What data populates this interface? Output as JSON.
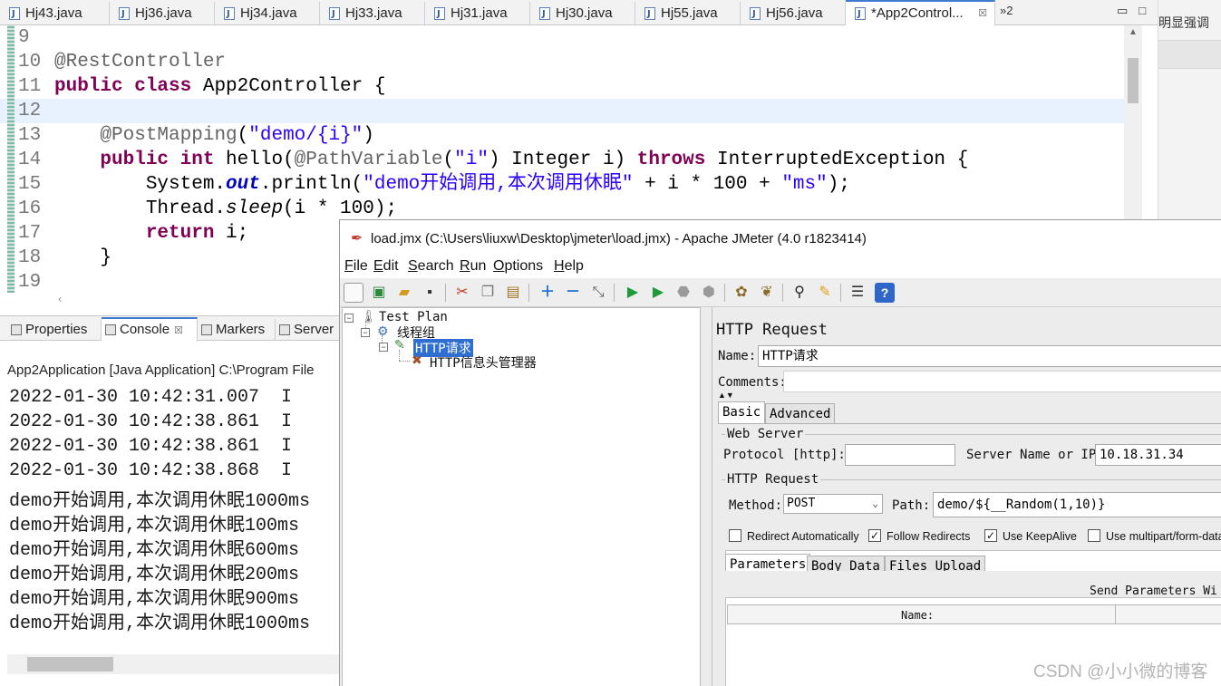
{
  "eclipse": {
    "tabs": [
      "Hj43.java",
      "Hj36.java",
      "Hj34.java",
      "Hj33.java",
      "Hj31.java",
      "Hj30.java",
      "Hj55.java",
      "Hj56.java",
      "*App2Control..."
    ],
    "tab_overflow": "»2",
    "right_strip_text": "明显强调",
    "code_lines": [
      {
        "num": "9",
        "segs": []
      },
      {
        "num": "10",
        "segs": [
          {
            "t": "@RestController",
            "c": "ann"
          }
        ]
      },
      {
        "num": "11",
        "segs": [
          {
            "t": "public class",
            "c": "kw"
          },
          {
            "t": " App2Controller {",
            "c": ""
          }
        ]
      },
      {
        "num": "12",
        "segs": []
      },
      {
        "num": "13",
        "segs": [
          {
            "t": "    ",
            "c": ""
          },
          {
            "t": "@PostMapping",
            "c": "ann"
          },
          {
            "t": "(",
            "c": ""
          },
          {
            "t": "\"demo/{i}\"",
            "c": "str"
          },
          {
            "t": ")",
            "c": ""
          }
        ]
      },
      {
        "num": "14",
        "segs": [
          {
            "t": "    ",
            "c": ""
          },
          {
            "t": "public int",
            "c": "kw"
          },
          {
            "t": " hello(",
            "c": ""
          },
          {
            "t": "@PathVariable",
            "c": "ann"
          },
          {
            "t": "(",
            "c": ""
          },
          {
            "t": "\"i\"",
            "c": "str"
          },
          {
            "t": ") Integer i) ",
            "c": ""
          },
          {
            "t": "throws",
            "c": "kw"
          },
          {
            "t": " InterruptedException {",
            "c": ""
          }
        ]
      },
      {
        "num": "15",
        "segs": [
          {
            "t": "        System.",
            "c": ""
          },
          {
            "t": "out",
            "c": "fld"
          },
          {
            "t": ".println(",
            "c": ""
          },
          {
            "t": "\"demo开始调用,本次调用休眠\"",
            "c": "str"
          },
          {
            "t": " + i * 100 + ",
            "c": ""
          },
          {
            "t": "\"ms\"",
            "c": "str"
          },
          {
            "t": ");",
            "c": ""
          }
        ]
      },
      {
        "num": "16",
        "segs": [
          {
            "t": "        Thread.",
            "c": ""
          },
          {
            "t": "sleep",
            "c": "it"
          },
          {
            "t": "(i * 100);",
            "c": ""
          }
        ]
      },
      {
        "num": "17",
        "segs": [
          {
            "t": "        ",
            "c": ""
          },
          {
            "t": "return",
            "c": "kw"
          },
          {
            "t": " i;",
            "c": ""
          }
        ]
      },
      {
        "num": "18",
        "segs": [
          {
            "t": "    }",
            "c": ""
          }
        ]
      },
      {
        "num": "19",
        "segs": []
      }
    ],
    "views": [
      {
        "label": "Properties"
      },
      {
        "label": "Console",
        "close": "☒"
      },
      {
        "label": "Markers"
      },
      {
        "label": "Server"
      }
    ],
    "console_title": "App2Application [Java Application] C:\\Program File",
    "console_lines": [
      "2022-01-30 10:42:31.007  I",
      "2022-01-30 10:42:38.861  I",
      "2022-01-30 10:42:38.861  I",
      "2022-01-30 10:42:38.868  I",
      "demo开始调用,本次调用休眠1000ms",
      "demo开始调用,本次调用休眠100ms",
      "demo开始调用,本次调用休眠600ms",
      "demo开始调用,本次调用休眠200ms",
      "demo开始调用,本次调用休眠900ms",
      "demo开始调用,本次调用休眠1000ms"
    ]
  },
  "jmeter": {
    "title": "load.jmx (C:\\Users\\liuxw\\Desktop\\jmeter\\load.jmx) - Apache JMeter (4.0 r1823414)",
    "menu": [
      "File",
      "Edit",
      "Search",
      "Run",
      "Options",
      "Help"
    ],
    "tree": {
      "test_plan": "Test Plan",
      "thread_group": "线程组",
      "http_request": "HTTP请求",
      "header_manager": "HTTP信息头管理器"
    },
    "panel": {
      "heading": "HTTP Request",
      "name_label": "Name:",
      "name_value": "HTTP请求",
      "comments_label": "Comments:",
      "tab_basic": "Basic",
      "tab_advanced": "Advanced",
      "web_server": "Web Server",
      "protocol_label": "Protocol [http]:",
      "protocol_value": "",
      "server_label": "Server Name or IP:",
      "server_value": "10.18.31.34",
      "http_request_group": "HTTP Request",
      "method_label": "Method:",
      "method_value": "POST",
      "path_label": "Path:",
      "path_value": "demo/${__Random(1,10)}",
      "checks": [
        {
          "label": "Redirect Automatically",
          "checked": false
        },
        {
          "label": "Follow Redirects",
          "checked": true
        },
        {
          "label": "Use KeepAlive",
          "checked": true
        },
        {
          "label": "Use multipart/form-data",
          "checked": false
        }
      ],
      "subtabs": [
        "Parameters",
        "Body Data",
        "Files Upload"
      ],
      "send_params": "Send Parameters Wi",
      "col_name": "Name:"
    }
  },
  "watermark": "CSDN @小小微的博客"
}
